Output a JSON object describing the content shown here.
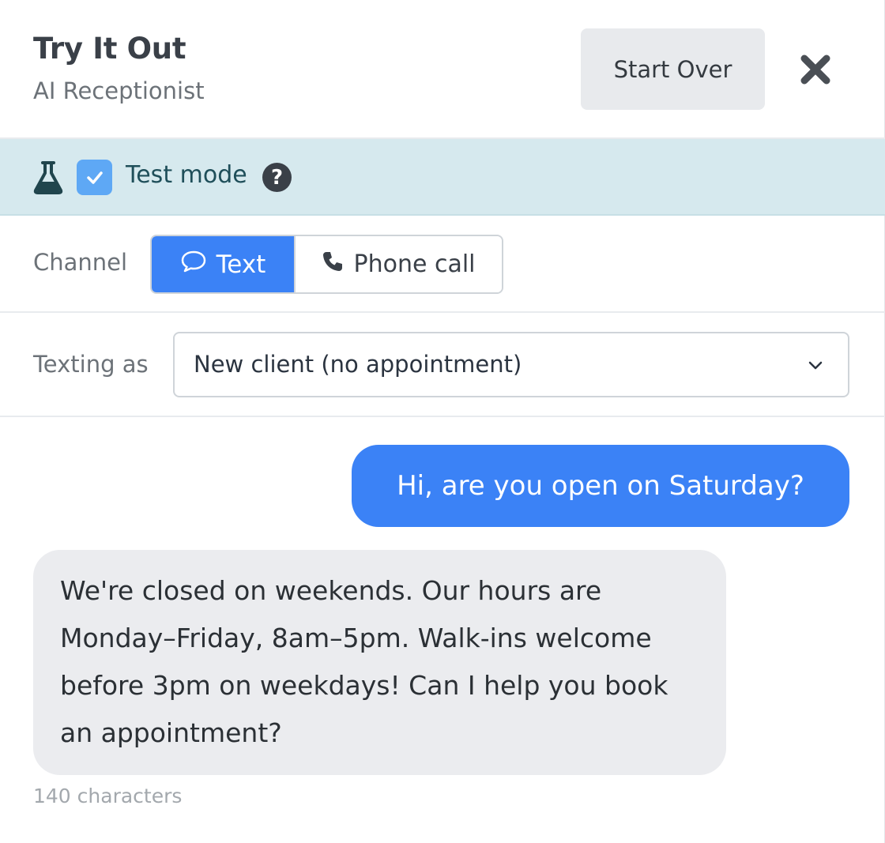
{
  "header": {
    "title": "Try It Out",
    "subtitle": "AI Receptionist",
    "start_over_label": "Start Over",
    "close_icon": "close-icon"
  },
  "test_mode": {
    "flask_icon": "flask-icon",
    "checked": true,
    "label": "Test mode",
    "help_icon": "help-icon",
    "help_glyph": "?",
    "background": "#d6e9ee"
  },
  "channel": {
    "label": "Channel",
    "options": [
      {
        "label": "Text",
        "icon": "chat-bubble-icon",
        "selected": true
      },
      {
        "label": "Phone call",
        "icon": "phone-icon",
        "selected": false
      }
    ],
    "accent": "#3b82f6"
  },
  "texting_as": {
    "label": "Texting as",
    "selected_value": "New client (no appointment)"
  },
  "conversation": {
    "messages": [
      {
        "from": "user",
        "text": "Hi, are you open on Saturday?"
      },
      {
        "from": "assistant",
        "text": "We're closed on weekends. Our hours are Monday–Friday, 8am–5pm. Walk-ins welcome before 3pm on weekdays! Can I help you book an appointment?"
      }
    ],
    "char_count": "140 characters"
  }
}
